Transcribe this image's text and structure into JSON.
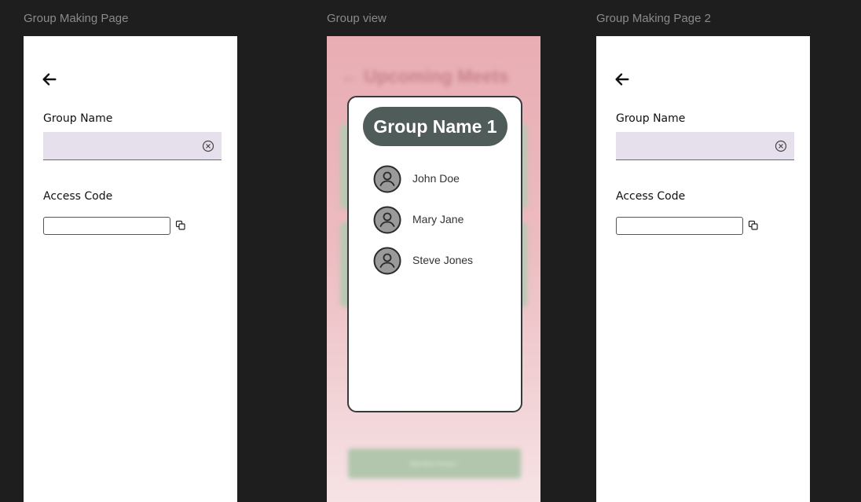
{
  "frames": {
    "group_making": {
      "label": "Group Making Page",
      "group_name_label": "Group Name",
      "group_name_value": "",
      "access_code_label": "Access Code",
      "access_code_value": ""
    },
    "group_view": {
      "label": "Group view",
      "background_title": "← Upcoming Meets",
      "add_group_button": "Add New Group +",
      "modal": {
        "group_name": "Group Name 1",
        "members": [
          {
            "name": "John Doe"
          },
          {
            "name": "Mary Jane"
          },
          {
            "name": "Steve Jones"
          }
        ]
      }
    },
    "group_making_2": {
      "label": "Group Making Page 2",
      "group_name_label": "Group Name",
      "group_name_value": "",
      "access_code_label": "Access Code",
      "access_code_value": ""
    }
  },
  "icons": {
    "back": "arrow-left-icon",
    "clear": "clear-circle-x-icon",
    "copy": "copy-icon",
    "avatar": "user-avatar-icon"
  },
  "colors": {
    "canvas_bg": "#1e1e1e",
    "input_fill": "#e6e0ec",
    "group_pill": "#4f5c59",
    "view_bg_top": "#e8adb3",
    "card_green": "#b8c9b1"
  }
}
